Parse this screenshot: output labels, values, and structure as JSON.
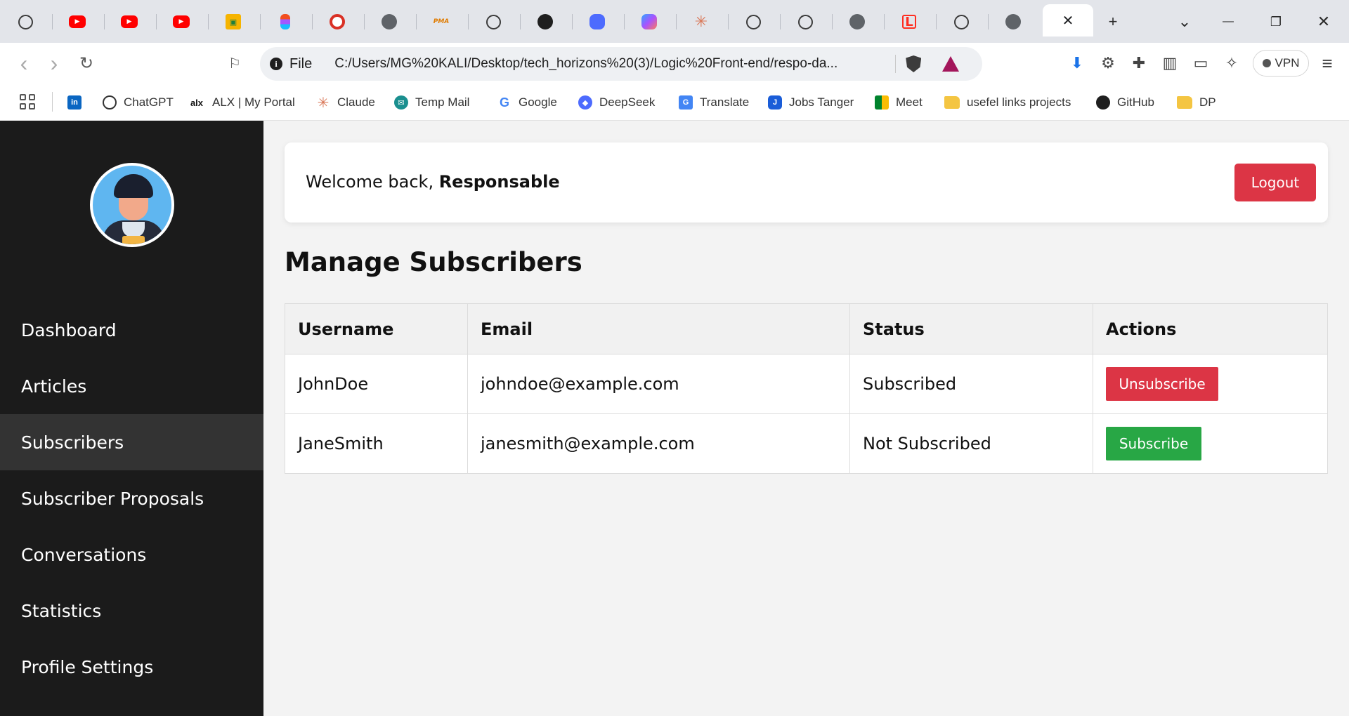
{
  "browser": {
    "tabs": [
      {
        "icon": "chatgpt-icon",
        "label": "⊛"
      },
      {
        "icon": "youtube-icon",
        "label": "▶"
      },
      {
        "icon": "youtube-icon",
        "label": "▶"
      },
      {
        "icon": "youtube-icon",
        "label": "▶"
      },
      {
        "icon": "google-classroom-icon",
        "label": "▣"
      },
      {
        "icon": "figma-icon",
        "label": ""
      },
      {
        "icon": "record-icon",
        "label": ""
      },
      {
        "icon": "globe-icon",
        "label": "◍"
      },
      {
        "icon": "phpmyadmin-icon",
        "label": "PMA"
      },
      {
        "icon": "chatgpt-icon",
        "label": "⊛"
      },
      {
        "icon": "github-icon",
        "label": "●"
      },
      {
        "icon": "deepseek-icon",
        "label": "◆"
      },
      {
        "icon": "copilot-icon",
        "label": "✦"
      },
      {
        "icon": "claude-icon",
        "label": "✳"
      },
      {
        "icon": "chatgpt-icon",
        "label": "⊛"
      },
      {
        "icon": "chatgpt-icon",
        "label": "⊛"
      },
      {
        "icon": "globe-icon",
        "label": "◍"
      },
      {
        "icon": "laravel-icon",
        "label": "L"
      },
      {
        "icon": "chatgpt-icon",
        "label": "⊛"
      },
      {
        "icon": "globe-icon",
        "label": "◍"
      }
    ],
    "active_tab_close": "✕",
    "new_tab": "+",
    "tab_search": "⌄",
    "window_minimize": "—",
    "window_restore": "❐",
    "window_close": "✕",
    "back": "‹",
    "forward": "›",
    "reload": "↻",
    "bookmark_star": "⚐",
    "file_label": "File",
    "url": "C:/Users/MG%20KALI/Desktop/tech_horizons%20(3)/Logic%20Front-end/respo-da...",
    "vpn_label": "VPN",
    "menu": "≡",
    "bookmarks": [
      {
        "icon": "linkedin-icon",
        "glyph": "in",
        "label": ""
      },
      {
        "icon": "chatgpt-icon",
        "glyph": "",
        "label": "ChatGPT"
      },
      {
        "icon": "alx-icon",
        "glyph": "alx",
        "label": "ALX | My Portal"
      },
      {
        "icon": "claude-icon",
        "glyph": "✳",
        "label": "Claude"
      },
      {
        "icon": "temp-mail-icon",
        "glyph": "✉",
        "label": "Temp Mail"
      },
      {
        "icon": "google-icon",
        "glyph": "G",
        "label": "Google"
      },
      {
        "icon": "deepseek-icon",
        "glyph": "◆",
        "label": "DeepSeek"
      },
      {
        "icon": "translate-icon",
        "glyph": "G",
        "label": "Translate"
      },
      {
        "icon": "jobs-tanger-icon",
        "glyph": "J",
        "label": "Jobs Tanger"
      },
      {
        "icon": "meet-icon",
        "glyph": "",
        "label": "Meet"
      },
      {
        "icon": "folder-icon",
        "glyph": "",
        "label": "usefel links projects"
      },
      {
        "icon": "github-icon",
        "glyph": "",
        "label": "GitHub"
      },
      {
        "icon": "folder-icon",
        "glyph": "",
        "label": "DP"
      }
    ]
  },
  "app": {
    "sidebar": {
      "items": [
        {
          "label": "Dashboard",
          "active": false
        },
        {
          "label": "Articles",
          "active": false
        },
        {
          "label": "Subscribers",
          "active": true
        },
        {
          "label": "Subscriber Proposals",
          "active": false
        },
        {
          "label": "Conversations",
          "active": false
        },
        {
          "label": "Statistics",
          "active": false
        },
        {
          "label": "Profile Settings",
          "active": false
        }
      ]
    },
    "header": {
      "welcome_prefix": "Welcome back, ",
      "welcome_name": "Responsable",
      "logout_label": "Logout"
    },
    "page_title": "Manage Subscribers",
    "table": {
      "columns": [
        "Username",
        "Email",
        "Status",
        "Actions"
      ],
      "rows": [
        {
          "username": "JohnDoe",
          "email": "johndoe@example.com",
          "status": "Subscribed",
          "action": "Unsubscribe"
        },
        {
          "username": "JaneSmith",
          "email": "janesmith@example.com",
          "status": "Not Subscribed",
          "action": "Subscribe"
        }
      ]
    }
  },
  "colors": {
    "sidebar_bg": "#1b1b1b",
    "sidebar_active": "#333333",
    "danger": "#dc3545",
    "success": "#28a745",
    "page_bg": "#f3f3f3"
  }
}
